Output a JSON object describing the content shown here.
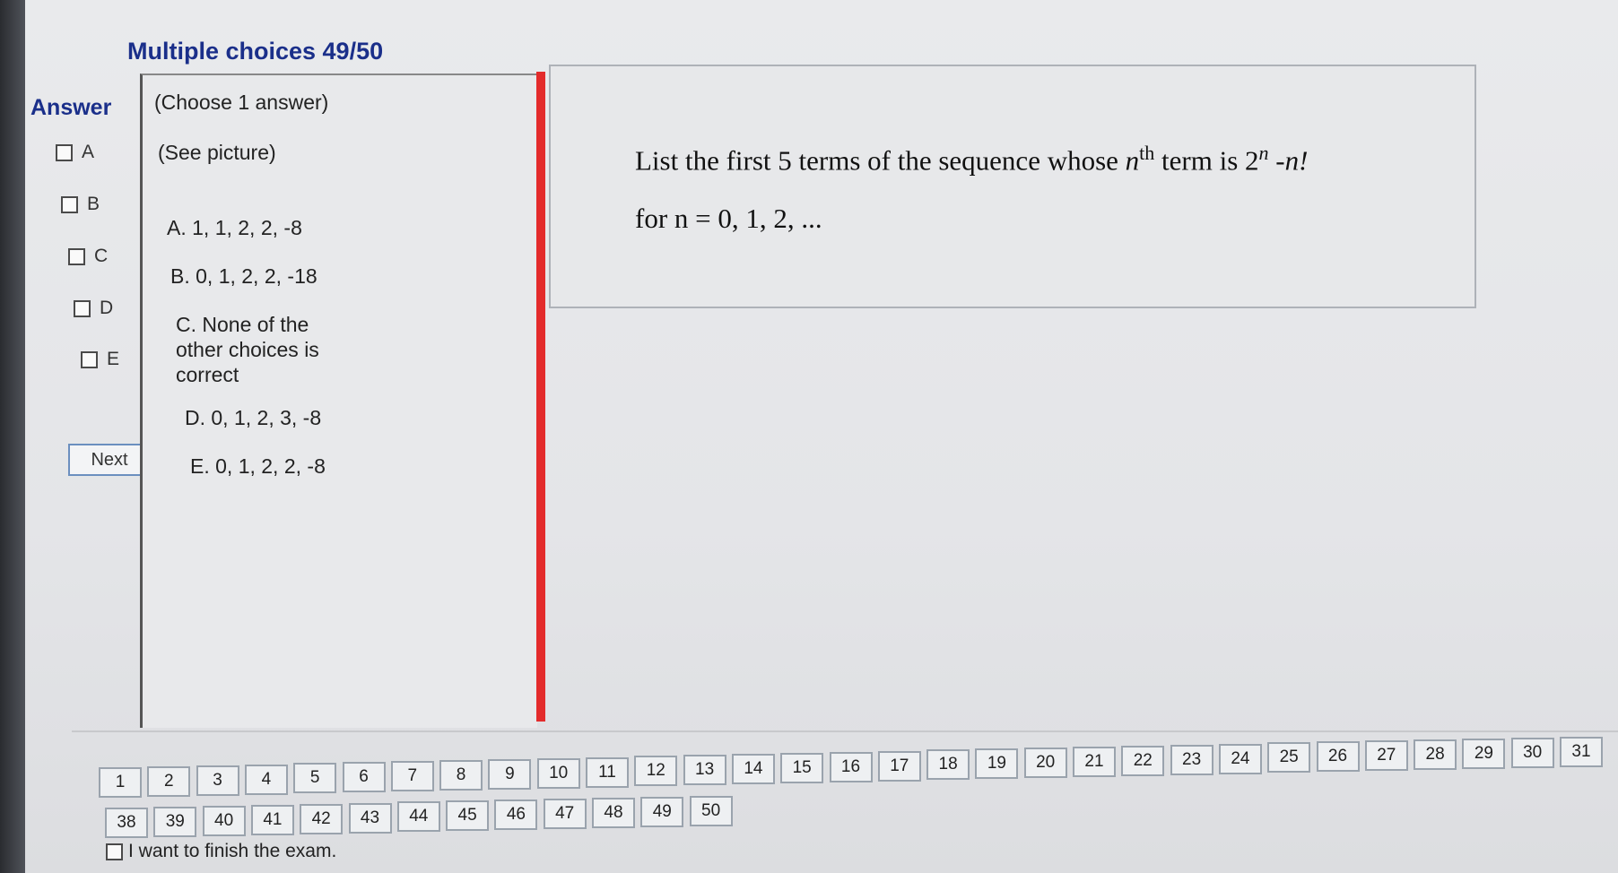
{
  "header": {
    "title": "Multiple choices 49/50",
    "answer_label": "Answer"
  },
  "answer_options": [
    "A",
    "B",
    "C",
    "D",
    "E"
  ],
  "next_label": "Next",
  "middle": {
    "choose": "(Choose 1 answer)",
    "see_picture": "(See picture)",
    "choices": [
      "A. 1, 1, 2, 2, -8",
      "B. 0, 1, 2, 2, -18",
      "C. None of the other choices is correct",
      "D. 0, 1, 2, 3, -8",
      "E. 0, 1, 2, 2, -8"
    ]
  },
  "question": {
    "part1": "List the first 5 terms of the sequence whose ",
    "n_var": "n",
    "th": "th",
    "part2": " term is 2",
    "exp": "n",
    "part3": " -",
    "n_end": "n!",
    "line2": "for n = 0, 1, 2, ..."
  },
  "nav": {
    "row1": [
      "1",
      "2",
      "3",
      "4",
      "5",
      "6",
      "7",
      "8",
      "9",
      "10",
      "11",
      "12",
      "13",
      "14",
      "15",
      "16",
      "17",
      "18",
      "19",
      "20",
      "21",
      "22",
      "23",
      "24",
      "25",
      "26",
      "27",
      "28",
      "29",
      "30",
      "31"
    ],
    "row2": [
      "38",
      "39",
      "40",
      "41",
      "42",
      "43",
      "44",
      "45",
      "46",
      "47",
      "48",
      "49",
      "50"
    ]
  },
  "finish_label": "I want to finish the exam."
}
